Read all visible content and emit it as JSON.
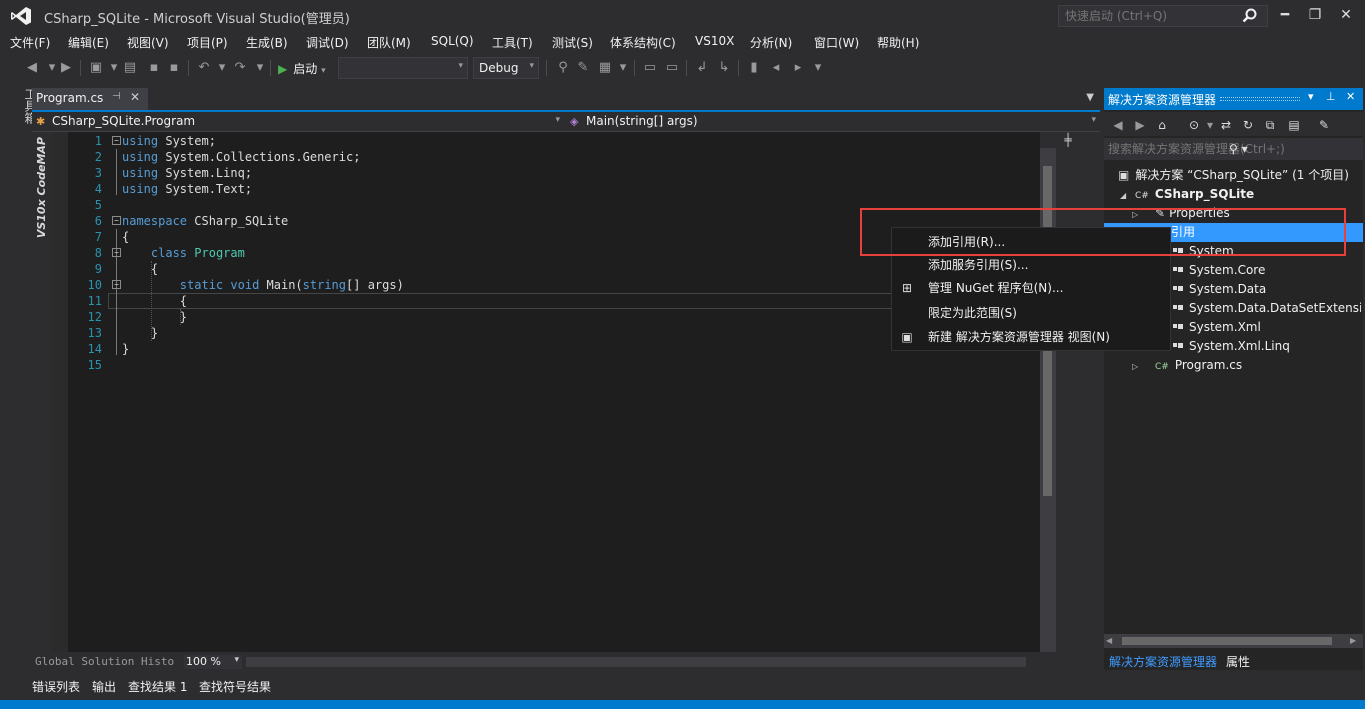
{
  "window": {
    "title": "CSharp_SQLite - Microsoft Visual Studio(管理员)",
    "quick_launch_placeholder": "快速启动 (Ctrl+Q)",
    "min": "━",
    "restore": "❐",
    "close": "✕"
  },
  "menu": [
    "文件(F)",
    "编辑(E)",
    "视图(V)",
    "项目(P)",
    "生成(B)",
    "调试(D)",
    "团队(M)",
    "SQL(Q)",
    "工具(T)",
    "测试(S)",
    "体系结构(C)",
    "VS10X",
    "分析(N)",
    "窗口(W)",
    "帮助(H)"
  ],
  "toolbar": {
    "start_label": "启动",
    "config": "Debug"
  },
  "left_strip": {
    "toolbox": "工具箱",
    "codemap": "VS10x CodeMAP"
  },
  "doc_tab": {
    "name": "Program.cs",
    "pin": "⊣",
    "close": "✕"
  },
  "nav": {
    "class_combo": "CSharp_SQLite.Program",
    "member_combo": "Main(string[] args)"
  },
  "code": {
    "lines": [
      {
        "n": "1",
        "parts": [
          [
            "kw",
            "using"
          ],
          [
            "",
            " System;"
          ]
        ]
      },
      {
        "n": "2",
        "parts": [
          [
            "kw",
            "using"
          ],
          [
            "",
            " System.Collections.Generic;"
          ]
        ]
      },
      {
        "n": "3",
        "parts": [
          [
            "kw",
            "using"
          ],
          [
            "",
            " System.Linq;"
          ]
        ]
      },
      {
        "n": "4",
        "parts": [
          [
            "kw",
            "using"
          ],
          [
            "",
            " System.Text;"
          ]
        ]
      },
      {
        "n": "5",
        "parts": []
      },
      {
        "n": "6",
        "parts": [
          [
            "kw",
            "namespace"
          ],
          [
            "",
            " CSharp_SQLite"
          ]
        ]
      },
      {
        "n": "7",
        "parts": [
          [
            "",
            "{"
          ]
        ]
      },
      {
        "n": "8",
        "parts": [
          [
            "",
            "    "
          ],
          [
            "kw",
            "class"
          ],
          [
            "",
            " "
          ],
          [
            "ty",
            "Program"
          ]
        ]
      },
      {
        "n": "9",
        "parts": [
          [
            "",
            "    {"
          ]
        ]
      },
      {
        "n": "10",
        "parts": [
          [
            "",
            "        "
          ],
          [
            "kw",
            "static"
          ],
          [
            "",
            " "
          ],
          [
            "kw",
            "void"
          ],
          [
            "",
            " Main("
          ],
          [
            "kw",
            "string"
          ],
          [
            "",
            "[] args)"
          ]
        ]
      },
      {
        "n": "11",
        "parts": [
          [
            "",
            "        {"
          ]
        ]
      },
      {
        "n": "12",
        "parts": [
          [
            "",
            "        }"
          ]
        ]
      },
      {
        "n": "13",
        "parts": [
          [
            "",
            "    }"
          ]
        ]
      },
      {
        "n": "14",
        "parts": [
          [
            "",
            "}"
          ]
        ]
      },
      {
        "n": "15",
        "parts": []
      }
    ]
  },
  "editor_bottom": {
    "global_history": "Global Solution Histo",
    "zoom": "100 %"
  },
  "output_tabs": [
    "错误列表",
    "输出",
    "查找结果 1",
    "查找符号结果"
  ],
  "solution_explorer": {
    "title": "解决方案资源管理器",
    "search_placeholder": "搜索解决方案资源管理器(Ctrl+;)",
    "solution": "解决方案 “CSharp_SQLite” (1 个项目)",
    "project": "CSharp_SQLite",
    "properties": "Properties",
    "references": "引用",
    "ref_items": [
      "System",
      "System.Core",
      "System.Data",
      "System.Data.DataSetExtensions",
      "System.Xml",
      "System.Xml.Linq"
    ],
    "program_file": "Program.cs",
    "bottom_tabs": [
      "解决方案资源管理器",
      "属性"
    ]
  },
  "context_menu": {
    "items": [
      "添加引用(R)...",
      "添加服务引用(S)...",
      "管理 NuGet 程序包(N)...",
      "限定为此范围(S)",
      "新建 解决方案资源管理器 视图(N)"
    ]
  },
  "colors": {
    "accent": "#007acc",
    "selection": "#3399ff",
    "highlight_box": "#e8403c",
    "keyword": "#569cd6",
    "type": "#4ec9b0",
    "line_number": "#2b91af"
  }
}
